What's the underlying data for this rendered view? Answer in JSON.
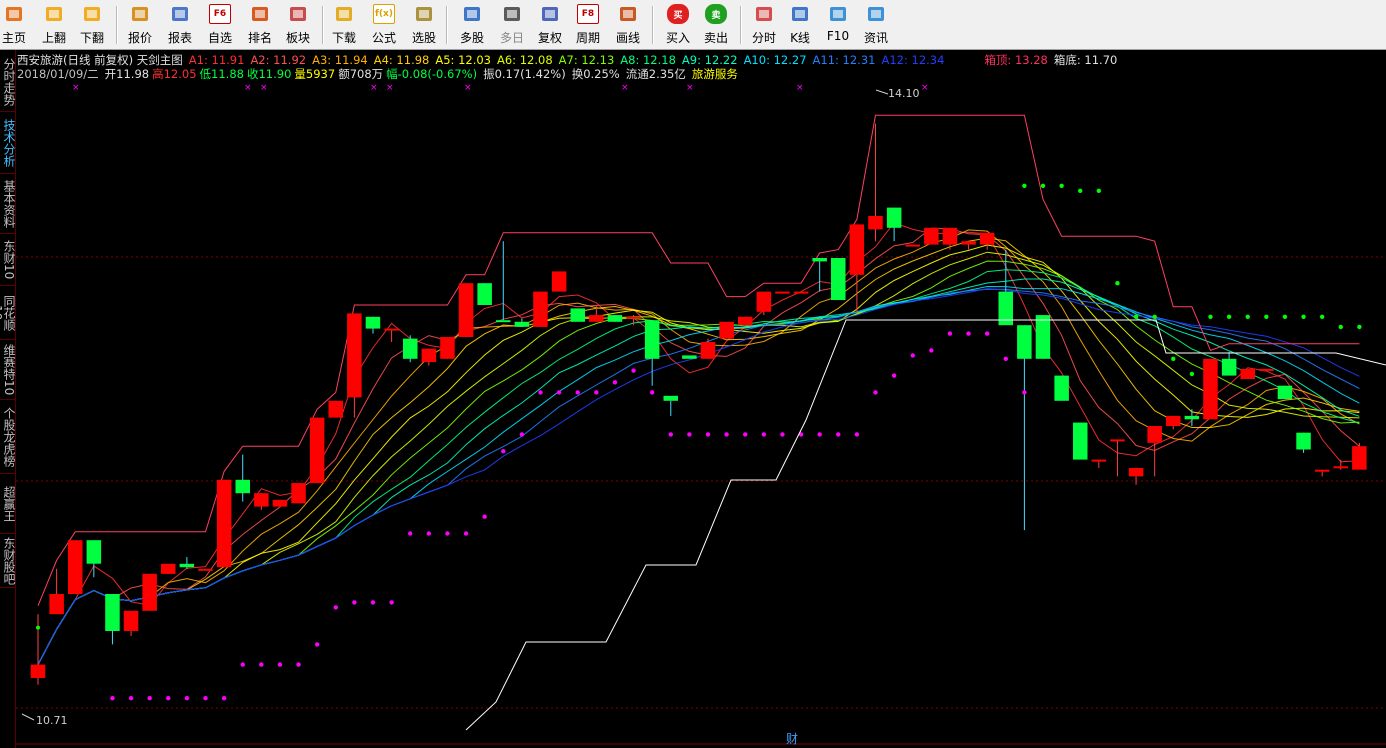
{
  "toolbar": {
    "items": [
      {
        "label": "主页",
        "icon": "home-icon"
      },
      {
        "label": "上翻",
        "icon": "page-up-icon"
      },
      {
        "label": "下翻",
        "icon": "page-down-icon"
      },
      {
        "label": "报价",
        "icon": "quote-icon"
      },
      {
        "label": "报表",
        "icon": "report-icon"
      },
      {
        "label": "自选",
        "icon": "watchlist-icon",
        "glyph": "F6"
      },
      {
        "label": "排名",
        "icon": "ranking-icon"
      },
      {
        "label": "板块",
        "icon": "sector-icon"
      },
      {
        "label": "下载",
        "icon": "download-icon"
      },
      {
        "label": "公式",
        "icon": "formula-icon",
        "glyph": "f(x)"
      },
      {
        "label": "选股",
        "icon": "stock-picker-icon"
      },
      {
        "label": "多股",
        "icon": "multi-stock-icon"
      },
      {
        "label": "多日",
        "icon": "multi-day-icon"
      },
      {
        "label": "复权",
        "icon": "adjust-icon"
      },
      {
        "label": "周期",
        "icon": "period-icon",
        "glyph": "F8"
      },
      {
        "label": "画线",
        "icon": "draw-line-icon"
      },
      {
        "label": "买入",
        "icon": "buy-icon",
        "glyph": "买"
      },
      {
        "label": "卖出",
        "icon": "sell-icon",
        "glyph": "卖"
      },
      {
        "label": "分时",
        "icon": "intraday-icon"
      },
      {
        "label": "K线",
        "icon": "kline-icon"
      },
      {
        "label": "F10",
        "icon": "f10-icon"
      },
      {
        "label": "资讯",
        "icon": "news-icon"
      }
    ]
  },
  "side_tabs": [
    {
      "label": "分时走势"
    },
    {
      "label": "技术分析"
    },
    {
      "label": "基本资料"
    },
    {
      "label": "东财10"
    },
    {
      "label": "同花顺10"
    },
    {
      "label": "维赛特10"
    },
    {
      "label": "个股龙虎榜"
    },
    {
      "label": "超赢王"
    },
    {
      "label": "东财股吧"
    }
  ],
  "header": {
    "title": "西安旅游(日线 前复权) 天剑主图",
    "averages": [
      {
        "label": "A1: 11.91",
        "color": "#ff3030"
      },
      {
        "label": "A2: 11.92",
        "color": "#ff5050"
      },
      {
        "label": "A3: 11.94",
        "color": "#ffb000"
      },
      {
        "label": "A4: 11.98",
        "color": "#ffd000"
      },
      {
        "label": "A5: 12.03",
        "color": "#ffff00"
      },
      {
        "label": "A6: 12.08",
        "color": "#e0ff00"
      },
      {
        "label": "A7: 12.13",
        "color": "#80ff00"
      },
      {
        "label": "A8: 12.18",
        "color": "#00ff80"
      },
      {
        "label": "A9: 12.22",
        "color": "#00ffc0"
      },
      {
        "label": "A10: 12.27",
        "color": "#00e0ff"
      },
      {
        "label": "A11: 12.31",
        "color": "#2080ff"
      },
      {
        "label": "A12: 12.34",
        "color": "#2040ff"
      }
    ],
    "box_top": "箱顶: 13.28",
    "box_bottom": "箱底: 11.70",
    "date": "2018/01/09/二",
    "open": "开11.98",
    "high": "高12.05",
    "low": "低11.88",
    "close": "收11.90",
    "volume": "量5937",
    "amount": "额708万",
    "change": "幅-0.08(-0.67%)",
    "amplitude": "振0.17(1.42%)",
    "turnover": "换0.25%",
    "float": "流通2.35亿",
    "industry": "旅游服务"
  },
  "chart_data": {
    "type": "candlestick",
    "price_range": [
      10.55,
      14.3
    ],
    "high_label": "14.10",
    "low_label": "10.71",
    "candles": [
      [
        10.8,
        11.18,
        10.76,
        10.88
      ],
      [
        11.18,
        11.45,
        11.18,
        11.3
      ],
      [
        11.3,
        11.62,
        11.3,
        11.62
      ],
      [
        11.62,
        11.62,
        11.4,
        11.48
      ],
      [
        11.3,
        11.3,
        11.0,
        11.08
      ],
      [
        11.08,
        11.2,
        11.05,
        11.2
      ],
      [
        11.2,
        11.42,
        11.2,
        11.42
      ],
      [
        11.42,
        11.48,
        11.42,
        11.48
      ],
      [
        11.48,
        11.52,
        11.45,
        11.46
      ],
      [
        11.45,
        11.45,
        11.45,
        11.45
      ],
      [
        11.46,
        11.98,
        11.46,
        11.98
      ],
      [
        11.98,
        12.13,
        11.85,
        11.9
      ],
      [
        11.82,
        11.9,
        11.8,
        11.9
      ],
      [
        11.82,
        11.86,
        11.82,
        11.86
      ],
      [
        11.84,
        11.96,
        11.84,
        11.96
      ],
      [
        11.96,
        12.35,
        11.96,
        12.35
      ],
      [
        12.35,
        12.45,
        12.35,
        12.45
      ],
      [
        12.47,
        12.97,
        12.35,
        12.97
      ],
      [
        12.95,
        12.95,
        12.85,
        12.88
      ],
      [
        12.88,
        12.88,
        12.8,
        12.88
      ],
      [
        12.82,
        12.84,
        12.68,
        12.7
      ],
      [
        12.68,
        12.76,
        12.66,
        12.76
      ],
      [
        12.7,
        12.83,
        12.7,
        12.83
      ],
      [
        12.83,
        13.15,
        12.83,
        13.15
      ],
      [
        13.15,
        13.15,
        13.02,
        13.02
      ],
      [
        12.93,
        13.4,
        12.93,
        12.92
      ],
      [
        12.92,
        12.94,
        12.92,
        12.89
      ],
      [
        12.89,
        13.1,
        12.89,
        13.1
      ],
      [
        13.1,
        13.22,
        13.1,
        13.22
      ],
      [
        13.0,
        13.0,
        12.98,
        12.92
      ],
      [
        12.92,
        13.02,
        12.92,
        12.96
      ],
      [
        12.96,
        12.96,
        12.92,
        12.92
      ],
      [
        12.94,
        12.96,
        12.9,
        12.95
      ],
      [
        12.93,
        12.93,
        12.54,
        12.7
      ],
      [
        12.48,
        12.45,
        12.36,
        12.45
      ],
      [
        12.72,
        12.72,
        12.72,
        12.7
      ],
      [
        12.7,
        12.82,
        12.7,
        12.8
      ],
      [
        12.82,
        12.92,
        12.82,
        12.92
      ],
      [
        12.9,
        12.95,
        12.9,
        12.95
      ],
      [
        12.98,
        13.1,
        12.96,
        13.1
      ],
      [
        13.1,
        13.1,
        13.1,
        13.1
      ],
      [
        13.1,
        13.1,
        13.1,
        13.1
      ],
      [
        13.3,
        13.28,
        13.1,
        13.28
      ],
      [
        13.3,
        13.3,
        13.05,
        13.05
      ],
      [
        13.2,
        13.48,
        12.98,
        13.5
      ],
      [
        13.47,
        14.1,
        13.4,
        13.55
      ],
      [
        13.6,
        13.6,
        13.4,
        13.48
      ],
      [
        13.38,
        13.38,
        13.38,
        13.38
      ],
      [
        13.38,
        13.38,
        13.38,
        13.48
      ],
      [
        13.38,
        13.38,
        13.35,
        13.48
      ],
      [
        13.38,
        13.38,
        13.35,
        13.4
      ],
      [
        13.38,
        13.38,
        13.35,
        13.45
      ],
      [
        13.1,
        13.35,
        13.05,
        12.9
      ],
      [
        12.9,
        12.9,
        11.68,
        12.7
      ],
      [
        12.96,
        12.96,
        12.7,
        12.7
      ],
      [
        12.6,
        12.6,
        12.5,
        12.45
      ],
      [
        12.32,
        12.32,
        12.18,
        12.1
      ],
      [
        12.1,
        12.1,
        12.05,
        12.1
      ],
      [
        12.22,
        12.22,
        12.0,
        12.22
      ],
      [
        12.0,
        12.0,
        11.95,
        12.05
      ],
      [
        12.2,
        12.2,
        12.0,
        12.3
      ],
      [
        12.3,
        12.36,
        12.28,
        12.36
      ],
      [
        12.36,
        12.4,
        12.3,
        12.34
      ],
      [
        12.34,
        12.7,
        12.34,
        12.7
      ],
      [
        12.7,
        12.74,
        12.6,
        12.6
      ],
      [
        12.58,
        12.6,
        12.58,
        12.64
      ],
      [
        12.64,
        12.64,
        12.64,
        12.64
      ],
      [
        12.54,
        12.54,
        12.48,
        12.46
      ],
      [
        12.26,
        12.26,
        12.14,
        12.16
      ],
      [
        12.04,
        12.04,
        12.0,
        12.04
      ],
      [
        12.06,
        12.1,
        12.04,
        12.06
      ],
      [
        12.04,
        12.2,
        12.06,
        12.18
      ]
    ],
    "colors": {
      "up": "#ff0000",
      "down": "#00ff40",
      "box_line": "#ff4060",
      "magenta_dots": "#ff00ff",
      "green_dots": "#00ff00",
      "white_line": "#ffffff"
    }
  },
  "bottom_label": "财"
}
